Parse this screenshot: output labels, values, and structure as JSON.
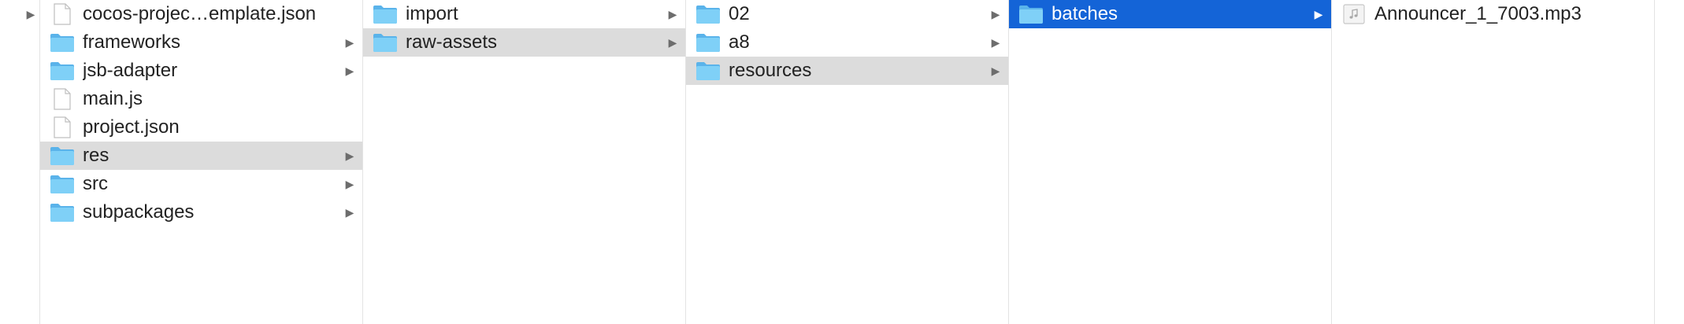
{
  "columns": {
    "c1": {
      "items": [
        {
          "label": "cocos-projec…emplate.json",
          "icon": "document-icon",
          "has_children": false
        },
        {
          "label": "frameworks",
          "icon": "folder-icon",
          "has_children": true
        },
        {
          "label": "jsb-adapter",
          "icon": "folder-icon",
          "has_children": true
        },
        {
          "label": "main.js",
          "icon": "document-icon",
          "has_children": false
        },
        {
          "label": "project.json",
          "icon": "document-icon",
          "has_children": false
        },
        {
          "label": "res",
          "icon": "folder-icon",
          "has_children": true,
          "state": "selected-inactive"
        },
        {
          "label": "src",
          "icon": "folder-icon",
          "has_children": true
        },
        {
          "label": "subpackages",
          "icon": "folder-icon",
          "has_children": true
        }
      ]
    },
    "c2": {
      "items": [
        {
          "label": "import",
          "icon": "folder-icon",
          "has_children": true
        },
        {
          "label": "raw-assets",
          "icon": "folder-icon",
          "has_children": true,
          "state": "selected-inactive"
        }
      ]
    },
    "c3": {
      "items": [
        {
          "label": "02",
          "icon": "folder-icon",
          "has_children": true
        },
        {
          "label": "a8",
          "icon": "folder-icon",
          "has_children": true
        },
        {
          "label": "resources",
          "icon": "folder-icon",
          "has_children": true,
          "state": "selected-inactive"
        }
      ]
    },
    "c4": {
      "items": [
        {
          "label": "batches",
          "icon": "folder-icon",
          "has_children": true,
          "state": "selected-active"
        }
      ]
    },
    "c5": {
      "items": [
        {
          "label": "Announcer_1_7003.mp3",
          "icon": "audio-file-icon",
          "has_children": false
        }
      ]
    }
  },
  "colors": {
    "selection_active": "#1464d7",
    "selection_inactive": "#dcdcdc",
    "folder": "#6cc4f5"
  }
}
